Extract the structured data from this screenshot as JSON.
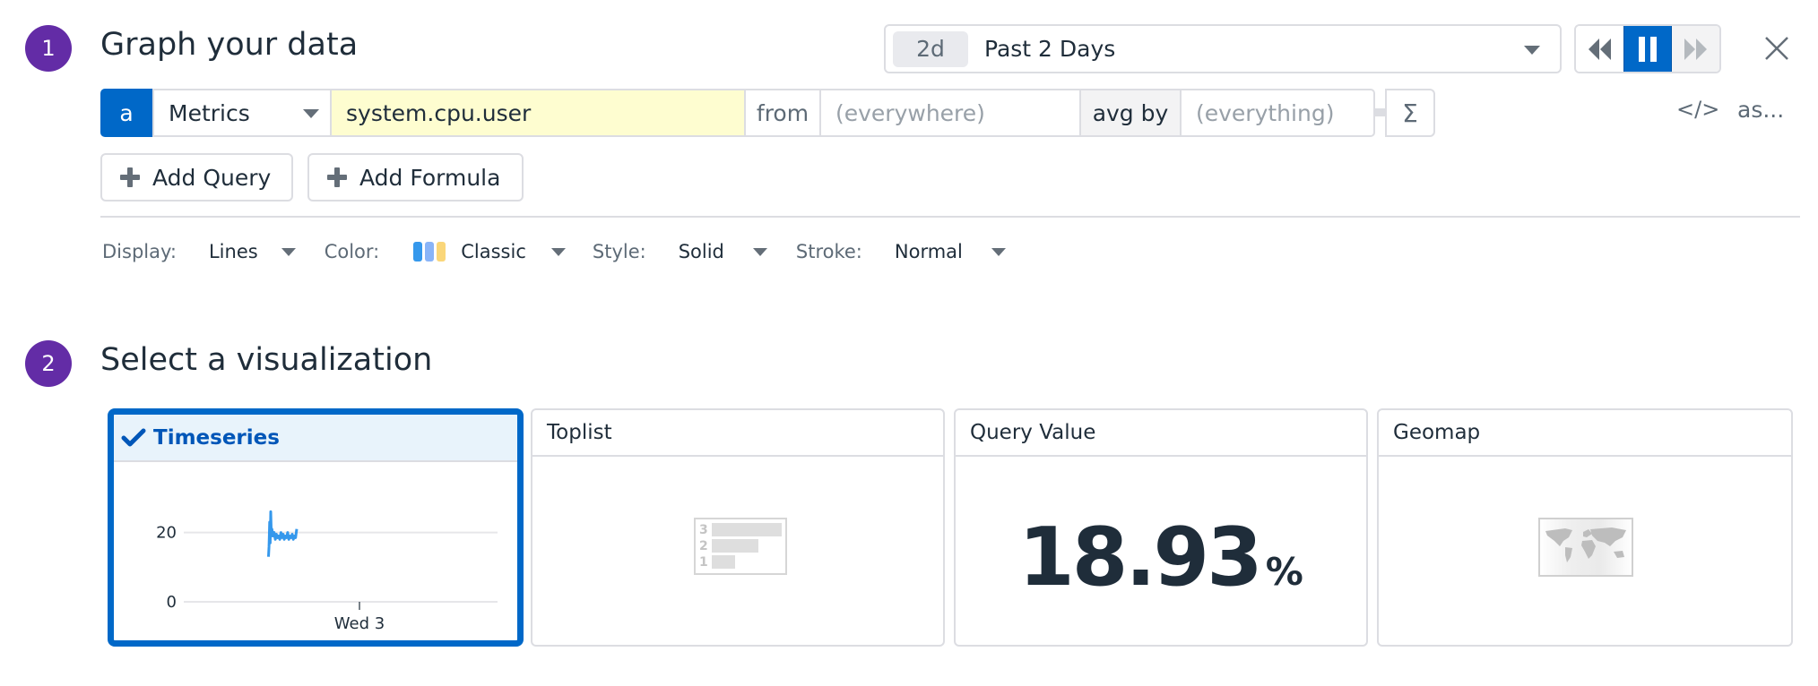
{
  "step1": {
    "number": "1",
    "title": "Graph your data"
  },
  "time_selector": {
    "badge": "2d",
    "label": "Past 2 Days"
  },
  "playback": {
    "rewind_icon": "rewind-icon",
    "pause_icon": "pause-icon",
    "forward_icon": "fast-forward-icon",
    "active": "pause"
  },
  "close_icon": "close-icon",
  "query": {
    "letter": "a",
    "source": "Metrics",
    "metric": "system.cpu.user",
    "from_label": "from",
    "from_placeholder": "(everywhere)",
    "aggregator": "avg by",
    "group_placeholder": "(everything)",
    "sigma": "Σ",
    "code_toggle": "</>",
    "alias": "as..."
  },
  "buttons": {
    "add_query": "Add Query",
    "add_formula": "Add Formula"
  },
  "display_options": {
    "display_label": "Display:",
    "display_value": "Lines",
    "color_label": "Color:",
    "color_value": "Classic",
    "color_swatches": [
      "#3598ec",
      "#89b4f8",
      "#fad679"
    ],
    "style_label": "Style:",
    "style_value": "Solid",
    "stroke_label": "Stroke:",
    "stroke_value": "Normal"
  },
  "step2": {
    "number": "2",
    "title": "Select a visualization"
  },
  "visualizations": [
    {
      "name": "Timeseries",
      "selected": true
    },
    {
      "name": "Toplist",
      "selected": false
    },
    {
      "name": "Query Value",
      "selected": false
    },
    {
      "name": "Geomap",
      "selected": false
    }
  ],
  "toplist_preview": {
    "ranks": [
      "3",
      "2",
      "1"
    ]
  },
  "query_value": {
    "value": "18.93",
    "unit": "%"
  },
  "chart_data": {
    "type": "line",
    "title": "",
    "xlabel": "",
    "ylabel": "",
    "y_ticks": [
      "20",
      "0"
    ],
    "y_tick_values": [
      20,
      0
    ],
    "x_tick_labels": [
      "Wed 3"
    ],
    "ylim": [
      0,
      31
    ],
    "series": [
      {
        "name": "system.cpu.user",
        "color": "#3598ec",
        "x": [
          0.0,
          0.01,
          0.02,
          0.03,
          0.04,
          0.05,
          0.06,
          0.08,
          0.1,
          0.12,
          0.14,
          0.16,
          0.18,
          0.2,
          0.22,
          0.24,
          0.26,
          0.28,
          0.3,
          0.32,
          0.34,
          0.36,
          0.38,
          0.4,
          0.42,
          0.44,
          0.46,
          0.48,
          0.5
        ],
        "values": [
          13,
          16,
          23,
          17,
          26,
          19,
          21,
          19,
          20,
          18,
          19.5,
          18.5,
          19,
          18,
          20,
          18.5,
          19.5,
          18,
          19,
          18.5,
          20,
          18,
          19,
          18.5,
          19.5,
          18,
          19,
          18.5,
          21
        ]
      }
    ]
  }
}
